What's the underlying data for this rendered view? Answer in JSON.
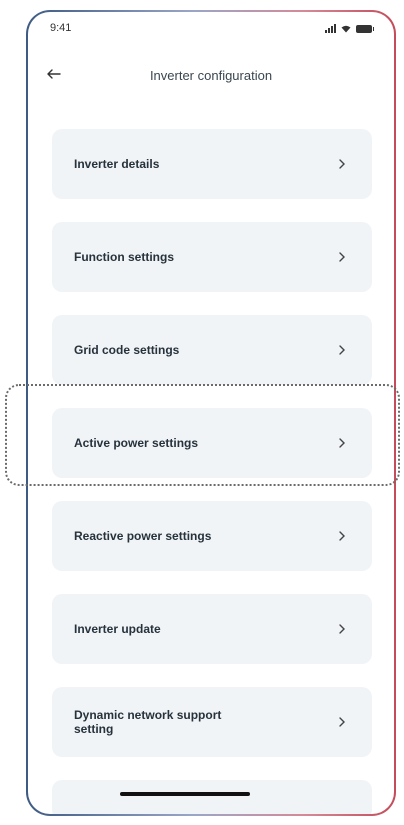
{
  "status": {
    "time": "9:41"
  },
  "header": {
    "title": "Inverter configuration"
  },
  "menu": {
    "items": [
      {
        "label": "Inverter details"
      },
      {
        "label": "Function settings"
      },
      {
        "label": "Grid code settings"
      },
      {
        "label": "Active power settings"
      },
      {
        "label": "Reactive power settings"
      },
      {
        "label": "Inverter update"
      },
      {
        "label": "Dynamic network support setting"
      }
    ]
  },
  "icons": {
    "back": "arrow-left-icon",
    "chevron": "chevron-right-icon",
    "signal": "signal-icon",
    "wifi": "wifi-icon",
    "battery": "battery-icon"
  },
  "colors": {
    "card_background": "#f1f4f6",
    "frame_left": "#3d5a82",
    "frame_right": "#c44b5a",
    "highlight_border": "#6b6b6b"
  },
  "highlight": {
    "target": "Active power settings"
  }
}
